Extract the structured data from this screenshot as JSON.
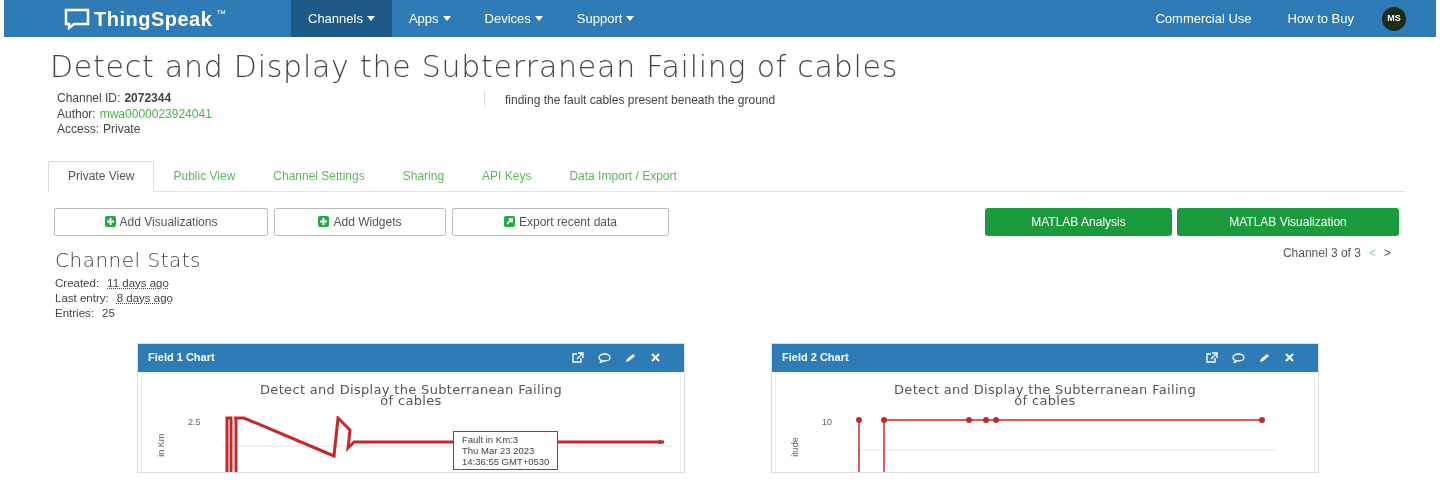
{
  "navbar": {
    "brand": "ThingSpeak",
    "trademark": "™",
    "menus": [
      {
        "label": "Channels",
        "selected": true
      },
      {
        "label": "Apps",
        "selected": false
      },
      {
        "label": "Devices",
        "selected": false
      },
      {
        "label": "Support",
        "selected": false
      }
    ],
    "right_links": [
      "Commercial Use",
      "How to Buy"
    ],
    "avatar": "MS"
  },
  "channel": {
    "title": "Detect and Display the Subterranean Failing of cables",
    "meta": [
      {
        "label": "Channel ID:",
        "value": "2072344",
        "kind": "bold"
      },
      {
        "label": "Author:",
        "value": "mwa0000023924041",
        "kind": "link"
      },
      {
        "label": "Access:",
        "value": "Private",
        "kind": "plain"
      }
    ],
    "description": "finding the fault cables present beneath the ground"
  },
  "tabs": [
    {
      "label": "Private View",
      "selected": true
    },
    {
      "label": "Public View",
      "selected": false
    },
    {
      "label": "Channel Settings",
      "selected": false
    },
    {
      "label": "Sharing",
      "selected": false
    },
    {
      "label": "API Keys",
      "selected": false
    },
    {
      "label": "Data Import / Export",
      "selected": false
    }
  ],
  "actions": [
    {
      "label": "Add Visualizations",
      "kind": "plus"
    },
    {
      "label": "Add Widgets",
      "kind": "plus"
    },
    {
      "label": "Export recent data",
      "kind": "export"
    }
  ],
  "matlab_buttons": [
    "MATLAB Analysis",
    "MATLAB Visualization"
  ],
  "pager": {
    "text": "Channel 3 of 3",
    "prev": "<",
    "next": ">"
  },
  "stats": {
    "title": "Channel Stats",
    "items": [
      {
        "label": "Created:",
        "value": "11 days ago",
        "kind": "time"
      },
      {
        "label": "Last entry:",
        "value": "8 days ago",
        "kind": "time"
      },
      {
        "label": "Entries:",
        "value": "25",
        "kind": "plain"
      }
    ]
  },
  "charts": [
    {
      "header": "Field 1 Chart",
      "title": [
        "Detect and Display the Subterranean Failing",
        "of cables"
      ],
      "y_axis_label": "in Km",
      "y_tick": "2.5",
      "tooltip": [
        "Fault in Km:3",
        "Thu Mar 23 2023",
        "14:36:55 GMT+0530"
      ],
      "kind": "zigzag"
    },
    {
      "header": "Field 2 Chart",
      "title": [
        "Detect and Display the Subterranean Failing",
        "of cables"
      ],
      "y_axis_label": "itude",
      "y_tick": "10",
      "kind": "flat"
    }
  ]
}
